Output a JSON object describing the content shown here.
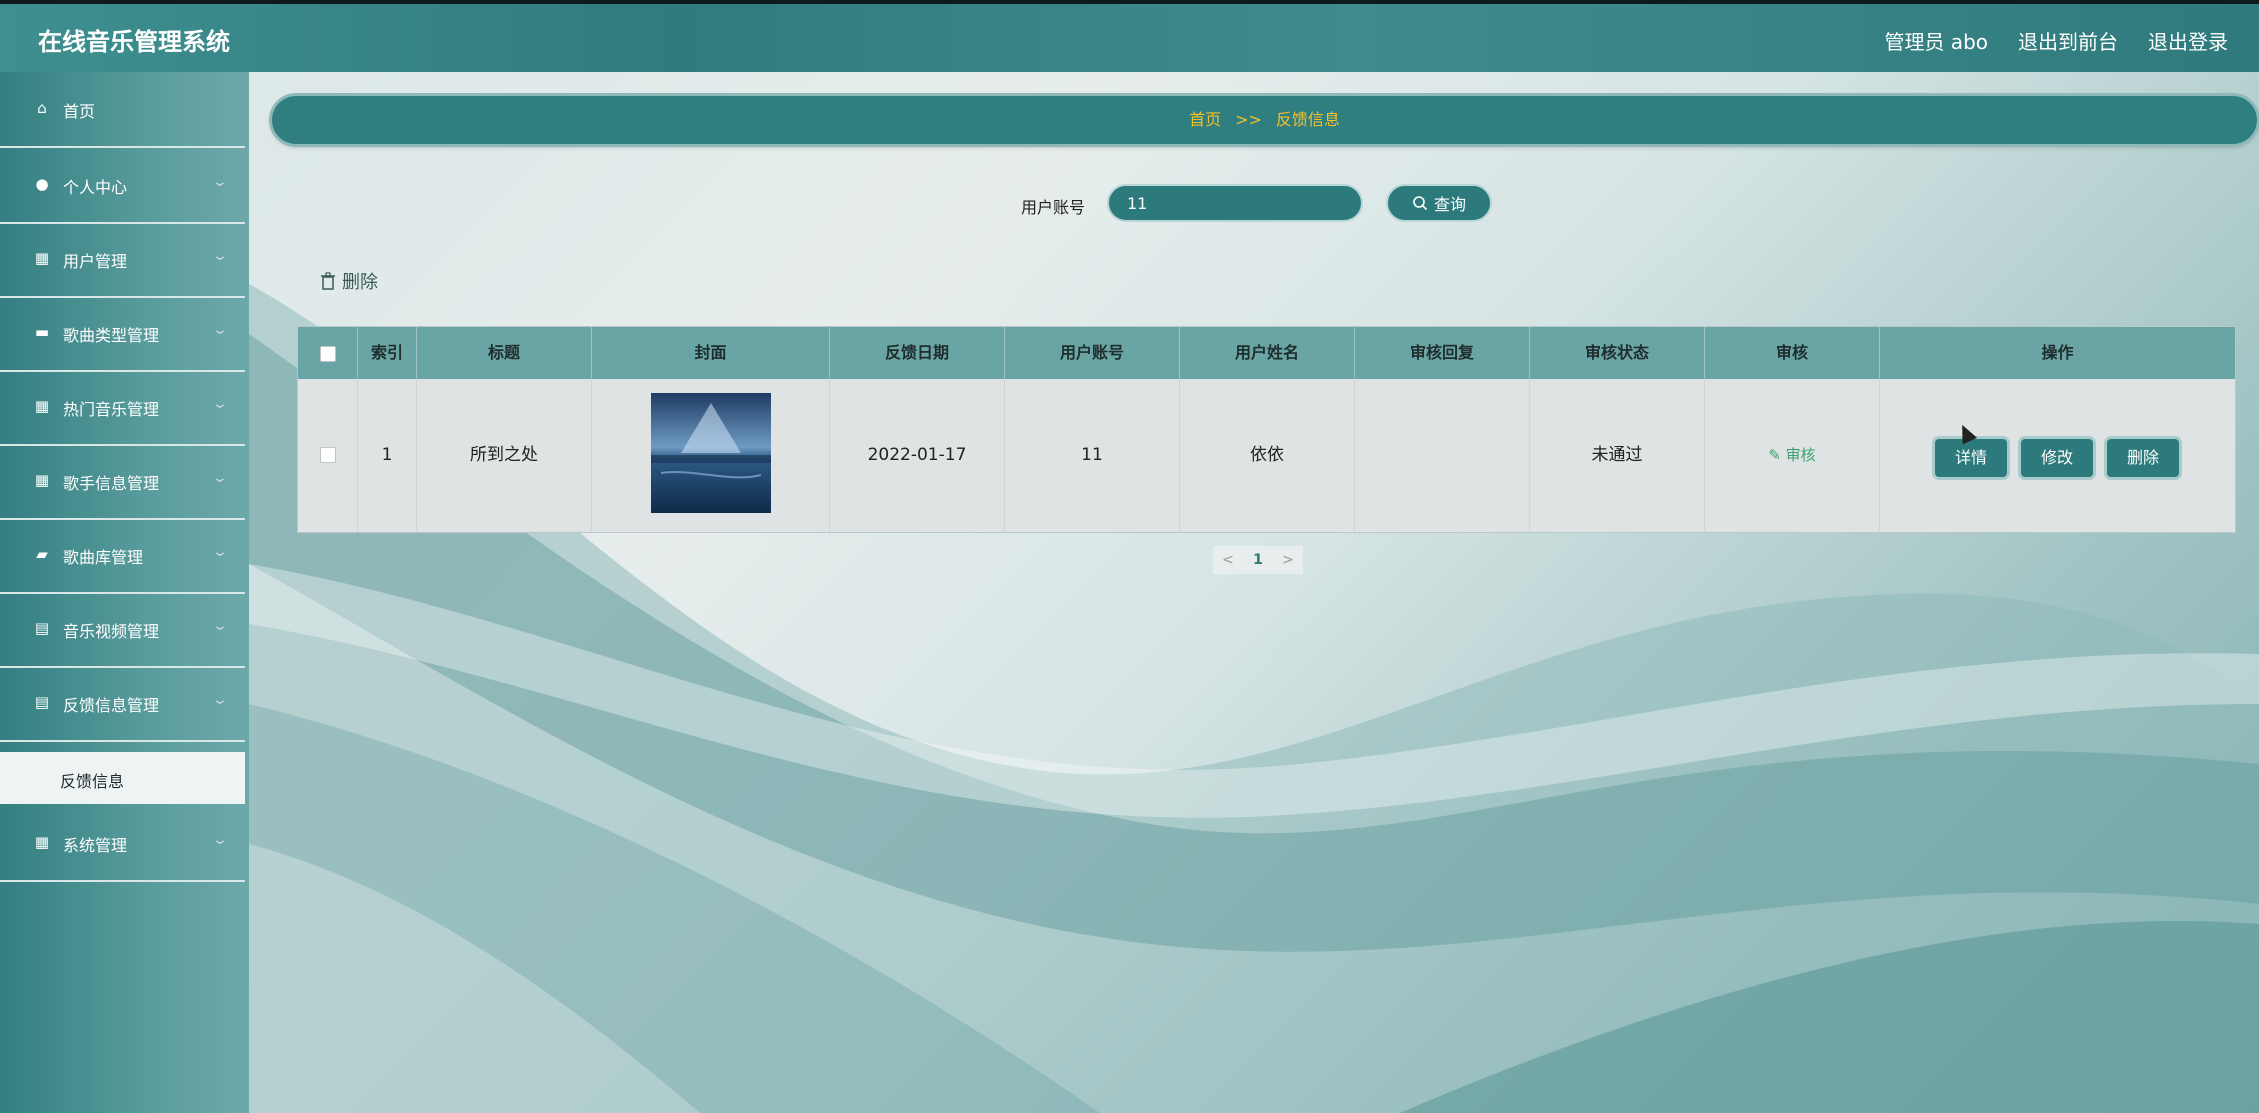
{
  "header": {
    "title": "在线音乐管理系统",
    "admin_label": "管理员 abo",
    "to_front_label": "退出到前台",
    "logout_label": "退出登录"
  },
  "sidebar": {
    "items": [
      {
        "label": "首页",
        "icon": "home-icon"
      },
      {
        "label": "个人中心",
        "icon": "user-icon"
      },
      {
        "label": "用户管理",
        "icon": "grid-icon"
      },
      {
        "label": "歌曲类型管理",
        "icon": "briefcase-icon"
      },
      {
        "label": "热门音乐管理",
        "icon": "grid-icon"
      },
      {
        "label": "歌手信息管理",
        "icon": "grid-icon"
      },
      {
        "label": "歌曲库管理",
        "icon": "ticket-icon"
      },
      {
        "label": "音乐视频管理",
        "icon": "clipboard-icon"
      },
      {
        "label": "反馈信息管理",
        "icon": "clipboard-icon"
      },
      {
        "label": "系统管理",
        "icon": "grid-icon"
      }
    ],
    "active_sub": "反馈信息"
  },
  "breadcrumb": {
    "home": "首页",
    "sep": ">>",
    "current": "反馈信息"
  },
  "search": {
    "label": "用户账号",
    "value": "11",
    "button": "查询"
  },
  "toolbar": {
    "delete_label": "删除"
  },
  "table": {
    "headers": [
      "索引",
      "标题",
      "封面",
      "反馈日期",
      "用户账号",
      "用户姓名",
      "审核回复",
      "审核状态",
      "审核",
      "操作"
    ],
    "rows": [
      {
        "index": "1",
        "title": "所到之处",
        "date": "2022-01-17",
        "account": "11",
        "name": "依依",
        "reply": "",
        "status": "未通过",
        "audit_link": "审核",
        "actions": [
          "详情",
          "修改",
          "删除"
        ]
      }
    ]
  },
  "pagination": {
    "prev": "<",
    "current": "1",
    "next": ">"
  },
  "colors": {
    "primary": "#2d7a7c",
    "accent": "#f5c02b",
    "audit": "#3aa36e"
  }
}
